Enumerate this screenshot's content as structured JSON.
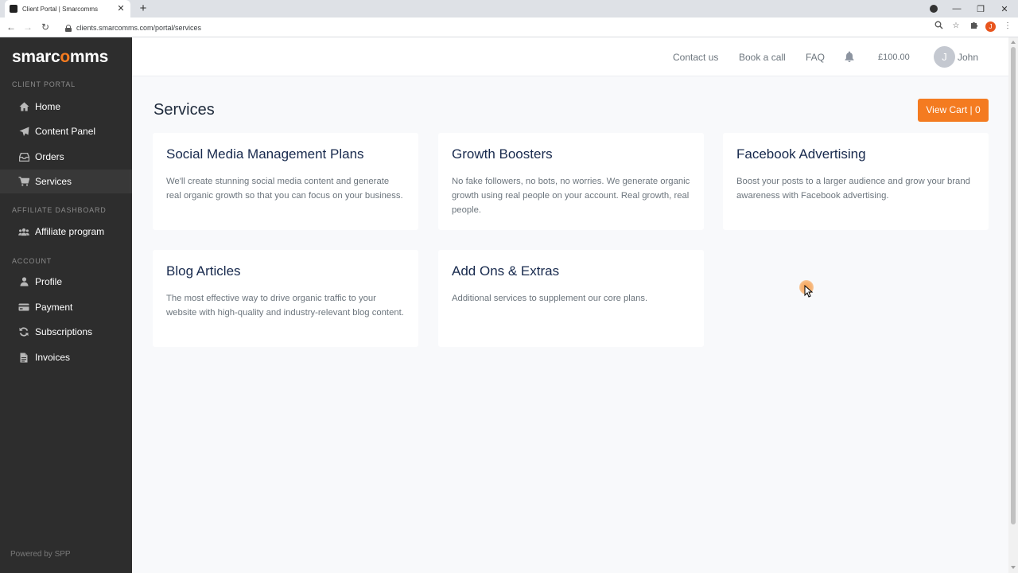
{
  "browser": {
    "tab_title": "Client Portal | Smarcomms",
    "url": "clients.smarcomms.com/portal/services",
    "ext_avatar_letter": "J"
  },
  "sidebar": {
    "logo_pre": "smarc",
    "logo_o": "o",
    "logo_post": "mms",
    "sections": [
      {
        "label": "CLIENT PORTAL",
        "items": [
          {
            "label": "Home",
            "icon": "home-icon"
          },
          {
            "label": "Content Panel",
            "icon": "paper-plane-icon"
          },
          {
            "label": "Orders",
            "icon": "inbox-icon"
          },
          {
            "label": "Services",
            "icon": "cart-icon",
            "active": true
          }
        ]
      },
      {
        "label": "AFFILIATE DASHBOARD",
        "items": [
          {
            "label": "Affiliate program",
            "icon": "users-icon"
          }
        ]
      },
      {
        "label": "ACCOUNT",
        "items": [
          {
            "label": "Profile",
            "icon": "user-icon"
          },
          {
            "label": "Payment",
            "icon": "credit-card-icon"
          },
          {
            "label": "Subscriptions",
            "icon": "refresh-icon"
          },
          {
            "label": "Invoices",
            "icon": "file-icon"
          }
        ]
      }
    ],
    "powered_by": "Powered by SPP"
  },
  "topbar": {
    "links": [
      "Contact us",
      "Book a call",
      "FAQ"
    ],
    "balance": "£100.00",
    "avatar_letter": "J",
    "user_name": "John"
  },
  "main": {
    "title": "Services",
    "cart_button": "View Cart | 0",
    "cards": [
      {
        "title": "Social Media Management Plans",
        "description": "We'll create stunning social media content and generate real organic growth so that you can focus on your business."
      },
      {
        "title": "Growth Boosters",
        "description": "No fake followers, no bots, no worries. We generate organic growth using real people on your account. Real growth, real people."
      },
      {
        "title": "Facebook Advertising",
        "description": "Boost your posts to a larger audience and grow your brand awareness with Facebook advertising."
      },
      {
        "title": "Blog Articles",
        "description": "The most effective way to drive organic traffic to your website with high-quality and industry-relevant blog content."
      },
      {
        "title": "Add Ons & Extras",
        "description": "Additional services to supplement our core plans."
      }
    ]
  },
  "colors": {
    "accent": "#f47b20",
    "sidebar_bg": "#2d2d2d",
    "heading": "#17294d"
  }
}
